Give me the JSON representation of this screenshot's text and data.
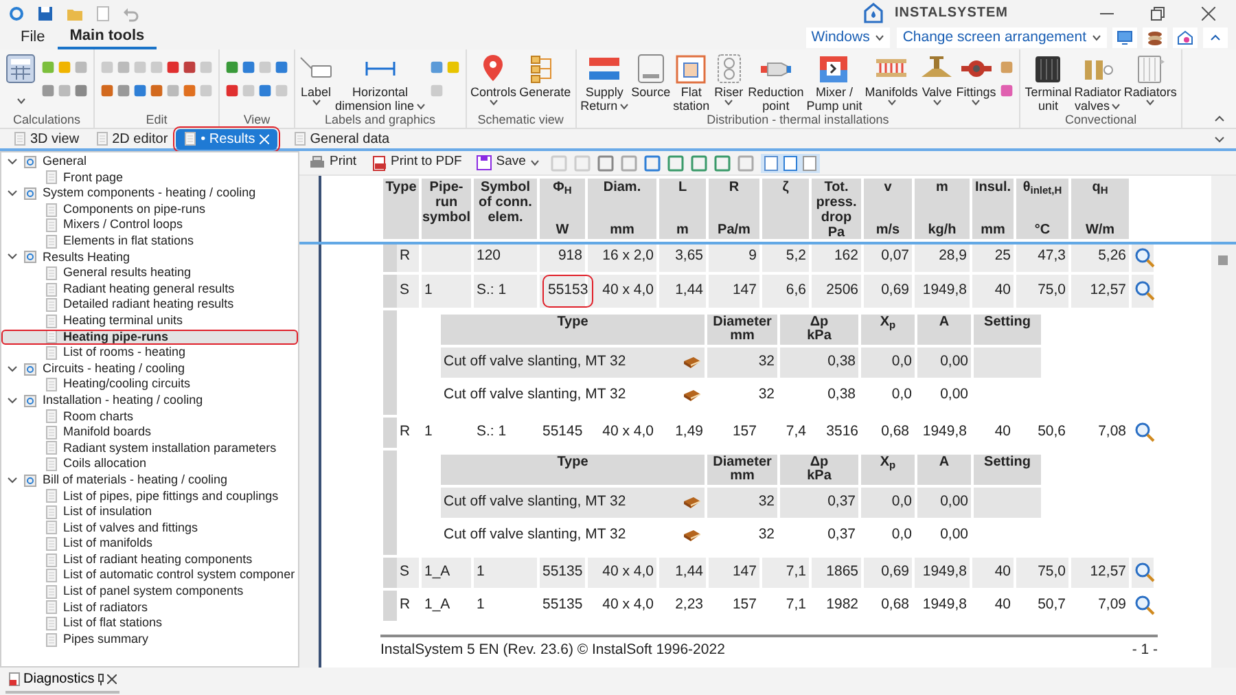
{
  "app": {
    "logo": "INSTALSYSTEM"
  },
  "ribbon_tabs": [
    {
      "label": "File",
      "selected": false
    },
    {
      "label": "Main tools",
      "selected": true
    }
  ],
  "quick_controls": [
    {
      "label": "Windows"
    },
    {
      "label": "Change screen arrangement"
    }
  ],
  "ribbon_groups": [
    {
      "label": "Calculations"
    },
    {
      "label": "Edit"
    },
    {
      "label": "View"
    },
    {
      "label": "Labels and graphics",
      "tools": [
        {
          "lines": [
            "Label"
          ],
          "dropdown": true
        },
        {
          "lines": [
            "Horizontal",
            "dimension line"
          ],
          "dropdown": true
        }
      ]
    },
    {
      "label": "Schematic view",
      "tools": [
        {
          "lines": [
            "Controls"
          ],
          "dropdown": true
        },
        {
          "lines": [
            "Generate"
          ],
          "dropdown": false
        }
      ]
    },
    {
      "label": "Distribution - thermal installations",
      "tools": [
        {
          "lines": [
            "Supply",
            "Return"
          ],
          "dropdown": true
        },
        {
          "lines": [
            "Source"
          ],
          "dropdown": false
        },
        {
          "lines": [
            "Flat",
            "station"
          ],
          "dropdown": false
        },
        {
          "lines": [
            "Riser"
          ],
          "dropdown": true
        },
        {
          "lines": [
            "Reduction",
            "point"
          ],
          "dropdown": false
        },
        {
          "lines": [
            "Mixer /",
            "Pump unit"
          ],
          "dropdown": false
        },
        {
          "lines": [
            "Manifolds"
          ],
          "dropdown": true
        },
        {
          "lines": [
            "Valve"
          ],
          "dropdown": true
        },
        {
          "lines": [
            "Fittings"
          ],
          "dropdown": true
        }
      ]
    },
    {
      "label": "Convectional",
      "tools": [
        {
          "lines": [
            "Terminal",
            "unit"
          ],
          "dropdown": false
        },
        {
          "lines": [
            "Radiator",
            "valves"
          ],
          "dropdown": true
        },
        {
          "lines": [
            "Radiators"
          ],
          "dropdown": true
        }
      ]
    }
  ],
  "doc_tabs": [
    {
      "label": "3D view",
      "selected": false
    },
    {
      "label": "2D editor",
      "selected": false
    },
    {
      "label": "• Results",
      "selected": true,
      "closable": true,
      "outlined": true
    },
    {
      "label": "General data",
      "selected": false
    }
  ],
  "tree": [
    {
      "label": "General",
      "expanded": true,
      "selected": false,
      "children": [
        {
          "label": "Front page",
          "selected": false
        }
      ]
    },
    {
      "label": "System components - heating / cooling",
      "expanded": true,
      "selected": false,
      "children": [
        {
          "label": "Components on pipe-runs",
          "selected": false
        },
        {
          "label": "Mixers / Control loops",
          "selected": false
        },
        {
          "label": "Elements in flat stations",
          "selected": false
        }
      ]
    },
    {
      "label": "Results Heating",
      "expanded": true,
      "selected": false,
      "children": [
        {
          "label": "General results heating",
          "selected": false
        },
        {
          "label": "Radiant heating general results",
          "selected": false
        },
        {
          "label": "Detailed radiant heating results",
          "selected": false
        },
        {
          "label": "Heating terminal units",
          "selected": false
        },
        {
          "label": "Heating pipe-runs",
          "selected": true,
          "outlined": true
        },
        {
          "label": "List of rooms - heating",
          "selected": false
        }
      ]
    },
    {
      "label": "Circuits - heating / cooling",
      "expanded": true,
      "selected": false,
      "children": [
        {
          "label": "Heating/cooling circuits",
          "selected": false
        }
      ]
    },
    {
      "label": "Installation - heating / cooling",
      "expanded": true,
      "selected": false,
      "children": [
        {
          "label": "Room charts",
          "selected": false
        },
        {
          "label": "Manifold boards",
          "selected": false
        },
        {
          "label": "Radiant system installation parameters",
          "selected": false
        },
        {
          "label": "Coils allocation",
          "selected": false
        }
      ]
    },
    {
      "label": "Bill of materials - heating / cooling",
      "expanded": true,
      "selected": false,
      "children": [
        {
          "label": "List of pipes, pipe fittings and couplings",
          "selected": false
        },
        {
          "label": "List of insulation",
          "selected": false
        },
        {
          "label": "List of valves and fittings",
          "selected": false
        },
        {
          "label": "List of manifolds",
          "selected": false
        },
        {
          "label": "List of radiant heating components",
          "selected": false
        },
        {
          "label": "List of automatic control system componer",
          "selected": false
        },
        {
          "label": "List of panel system components",
          "selected": false
        },
        {
          "label": "List of radiators",
          "selected": false
        },
        {
          "label": "List of flat stations",
          "selected": false
        },
        {
          "label": "Pipes summary",
          "selected": false
        }
      ]
    }
  ],
  "report_toolbar": [
    {
      "label": "Print",
      "dropdown": false
    },
    {
      "label": "Print to PDF",
      "dropdown": false
    },
    {
      "label": "Save",
      "dropdown": true
    }
  ],
  "report": {
    "columns": [
      {
        "name": "Type"
      },
      {
        "name": "Pipe-run symbol"
      },
      {
        "name": "Symbol of conn. elem."
      },
      {
        "name": "Φ$_{H}$",
        "unit": "W"
      },
      {
        "name": "Diam.",
        "unit": "mm"
      },
      {
        "name": "L",
        "unit": "m"
      },
      {
        "name": "R",
        "unit": "Pa/m"
      },
      {
        "name": "ζ"
      },
      {
        "name": "Tot. press. drop",
        "unit": "Pa"
      },
      {
        "name": "v",
        "unit": "m/s"
      },
      {
        "name": "m",
        "unit": "kg/h"
      },
      {
        "name": "Insul.",
        "unit": "mm"
      },
      {
        "name": "θ$_{inlet,H}$",
        "unit": "°C"
      },
      {
        "name": "q$_{H}$",
        "unit": "W/m"
      }
    ],
    "rows": [
      {
        "kind": "run",
        "shaded": true,
        "cells": [
          "R",
          null,
          "120",
          "918",
          "16 x 2,0",
          "3,65",
          "9",
          "5,2",
          "162",
          "0,07",
          "28,9",
          "25",
          "47,3",
          "5,26"
        ]
      },
      {
        "kind": "run",
        "shaded": true,
        "cells": [
          "S",
          "1",
          "S.: 1",
          {
            "text": "55153",
            "outlined": true
          },
          "40 x 4,0",
          "1,44",
          "147",
          "6,6",
          "2506",
          "0,69",
          "1949,8",
          "40",
          "75,0",
          "12,57"
        ]
      },
      {
        "kind": "components",
        "columns": [
          {
            "name": "Type"
          },
          {
            "name": "Diameter",
            "unit": "mm"
          },
          {
            "name": "Δp",
            "unit": "kPa"
          },
          {
            "name": "X$_{p}$"
          },
          {
            "name": "A"
          },
          {
            "name": "Setting"
          }
        ],
        "rows": [
          {
            "shaded": true,
            "cells": [
              "Cut off valve slanting, MT 32",
              "32",
              "0,38",
              "0,0",
              "0,00",
              null
            ]
          },
          {
            "shaded": false,
            "cells": [
              "Cut off valve slanting, MT 32",
              "32",
              "0,38",
              "0,0",
              "0,00",
              null
            ]
          }
        ]
      },
      {
        "kind": "run",
        "shaded": false,
        "cells": [
          "R",
          "1",
          "S.: 1",
          "55145",
          "40 x 4,0",
          "1,49",
          "157",
          "7,4",
          "3516",
          "0,68",
          "1949,8",
          "40",
          "50,6",
          "7,08"
        ]
      },
      {
        "kind": "components",
        "columns": [
          {
            "name": "Type"
          },
          {
            "name": "Diameter",
            "unit": "mm"
          },
          {
            "name": "Δp",
            "unit": "kPa"
          },
          {
            "name": "X$_{p}$"
          },
          {
            "name": "A"
          },
          {
            "name": "Setting"
          }
        ],
        "rows": [
          {
            "shaded": true,
            "cells": [
              "Cut off valve slanting, MT 32",
              "32",
              "0,37",
              "0,0",
              "0,00",
              null
            ]
          },
          {
            "shaded": false,
            "cells": [
              "Cut off valve slanting, MT 32",
              "32",
              "0,37",
              "0,0",
              "0,00",
              null
            ]
          }
        ]
      },
      {
        "kind": "run",
        "shaded": true,
        "cells": [
          "S",
          "1_A",
          "1",
          "55135",
          "40 x 4,0",
          "1,44",
          "147",
          "7,1",
          "1865",
          "0,69",
          "1949,8",
          "40",
          "75,0",
          "12,57"
        ]
      },
      {
        "kind": "run",
        "shaded": false,
        "cells": [
          "R",
          "1_A",
          "1",
          "55135",
          "40 x 4,0",
          "2,23",
          "157",
          "7,1",
          "1982",
          "0,68",
          "1949,8",
          "40",
          "50,7",
          "7,09"
        ]
      }
    ],
    "footer": {
      "text": "InstalSystem 5 EN (Rev. 23.6) © InstalSoft 1996-2022",
      "page": "- 1 -"
    }
  },
  "bottom_tabs": [
    {
      "label": "Diagnostics"
    }
  ]
}
